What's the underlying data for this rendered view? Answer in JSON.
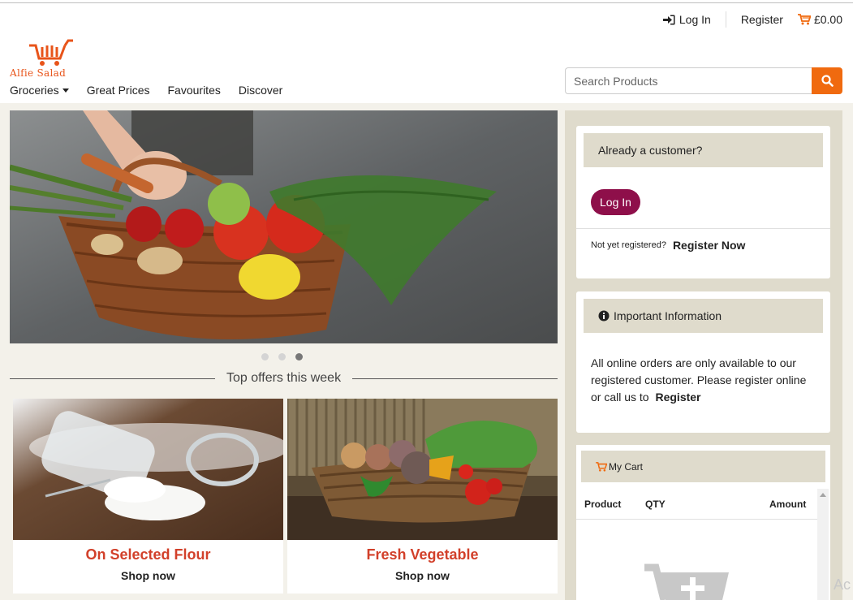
{
  "header": {
    "login_label": "Log In",
    "register_label": "Register",
    "cart_total": "£0.00",
    "logo_text": "Alfie Salad"
  },
  "nav": {
    "items": [
      "Groceries",
      "Great Prices",
      "Favourites",
      "Discover"
    ]
  },
  "search": {
    "placeholder": "Search Products"
  },
  "carousel": {
    "slide_count": 3,
    "active_slide": 3
  },
  "offers": {
    "heading": "Top offers this week",
    "cards": [
      {
        "title": "On Selected Flour",
        "action": "Shop now"
      },
      {
        "title": "Fresh Vegetable",
        "action": "Shop now"
      }
    ]
  },
  "sidebar": {
    "customer_box": {
      "heading": "Already a customer?",
      "login_button": "Log In",
      "not_registered": "Not yet registered?",
      "register_link": "Register Now"
    },
    "info_box": {
      "heading": "Important Information",
      "body": "All online orders are only available to our registered customer. Please register online or call us to",
      "link": "Register"
    },
    "cart_box": {
      "heading": "My Cart",
      "columns": [
        "Product",
        "QTY",
        "Amount"
      ]
    }
  },
  "overlay": {
    "watermark": "Ac"
  },
  "colors": {
    "accent_orange": "#f06a0f",
    "login_button": "#8e0f4a",
    "offer_title": "#d2402a",
    "panel_bg": "#dfdbcc",
    "page_bg": "#f3f1ea"
  }
}
